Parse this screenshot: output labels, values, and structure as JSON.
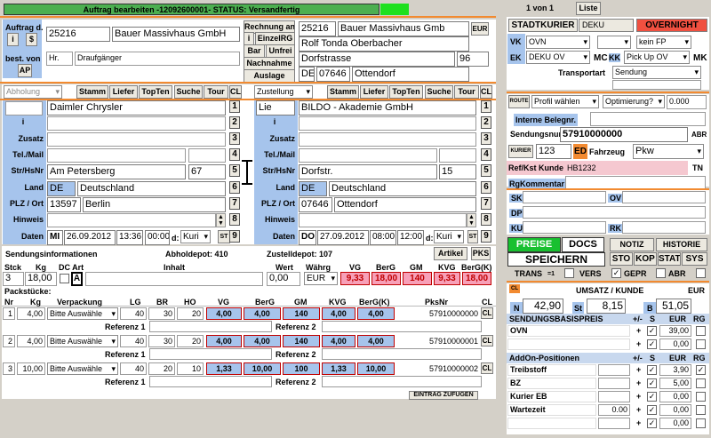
{
  "status_bar": {
    "text": "Auftrag bearbeiten    -12092600001-    STATUS: Versandfertig"
  },
  "left_header": {
    "auftrag_label": "Auftrag d.",
    "i_btn": "i",
    "s_btn": "$",
    "best_von_label": "best. von",
    "ap_btn": "AP",
    "customer_no": "25216",
    "customer_name": "Bauer Massivhaus GmbH",
    "salutation": "Hr.",
    "contact": "Draufgänger",
    "rechnung_an": "Rechnung an",
    "i2": "i",
    "einzelrg": "EinzelRG",
    "bar": "Bar",
    "unfrei": "Unfrei",
    "nachnahme": "Nachnahme",
    "auslage": "Auslage",
    "bill_no": "25216",
    "bill_name": "Bauer Massivhaus Gmb",
    "eur": "EUR",
    "bill_contact": "Rolf Tonda Oberbacher",
    "bill_street": "Dorfstrasse",
    "bill_house": "96",
    "bill_country": "DE",
    "bill_zip": "07646",
    "bill_city": "Ottendorf"
  },
  "pickup": {
    "mode": "Abholung",
    "buttons": [
      "Stamm",
      "Liefer",
      "TopTen",
      "Suche",
      "Tour",
      "CL"
    ],
    "company": "Daimler Chrysler",
    "street": "Am Petersberg",
    "house": "67",
    "country_code": "DE",
    "country": "Deutschland",
    "zip": "13597",
    "city": "Berlin",
    "day": "MI",
    "date": "26.09.2012",
    "time_from": "13:36",
    "time_to": "00:00",
    "d_label": "d:",
    "d_value": "Kuri",
    "st": "ST"
  },
  "delivery": {
    "mode": "Zustellung",
    "buttons": [
      "Stamm",
      "Liefer",
      "TopTen",
      "Suche",
      "Tour",
      "CL"
    ],
    "salutation": "Lie",
    "company": "BILDO - Akademie GmbH",
    "street": "Dorfstr.",
    "house": "15",
    "country_code": "DE",
    "country": "Deutschland",
    "zip": "07646",
    "city": "Ottendorf",
    "day": "DO",
    "date": "27.09.2012",
    "time_from": "08:00",
    "time_to": "12:00",
    "d_label": "d:",
    "d_value": "Kuri",
    "st": "ST"
  },
  "row_labels": [
    "i",
    "Zusatz",
    "Tel./Mail",
    "Str/HsNr",
    "Land",
    "PLZ / Ort",
    "Hinweis",
    "Daten"
  ],
  "row_numbers": [
    "1",
    "2",
    "3",
    "4",
    "5",
    "6",
    "7",
    "8",
    "9"
  ],
  "info": {
    "sendungsinfo": "Sendungsinformationen",
    "abholdepot": "Abholdepot: 410",
    "zustelldepot": "Zustelldepot: 107",
    "artikel": "Artikel",
    "pks": "PKS"
  },
  "summary": {
    "headers": [
      "Stck",
      "Kg",
      "DC Art",
      "Inhalt",
      "Wert",
      "Währg",
      "VG",
      "BerG",
      "GM",
      "KVG",
      "BerG(K)"
    ],
    "stck": "3",
    "kg": "18,00",
    "art": "A",
    "wert": "0,00",
    "waehrung": "EUR",
    "vg": "9,33",
    "berg": "18,00",
    "gm": "140",
    "kvg": "9,33",
    "bergk": "18,00"
  },
  "packages": {
    "title": "Packstücke:",
    "headers": [
      "Nr",
      "Kg",
      "Verpackung",
      "LG",
      "BR",
      "HO",
      "VG",
      "BerG",
      "GM",
      "KVG",
      "BerG(K)",
      "PksNr",
      "CL"
    ],
    "ref1": "Referenz 1",
    "ref2": "Referenz 2",
    "rows": [
      {
        "nr": "1",
        "kg": "4,00",
        "pack": "Bitte Auswähle",
        "lg": "40",
        "br": "30",
        "ho": "20",
        "vg": "4,00",
        "berg": "4,00",
        "gm": "140",
        "kvg": "4,00",
        "bergk": "4,00",
        "pksnr": "57910000000",
        "cl": "CL"
      },
      {
        "nr": "2",
        "kg": "4,00",
        "pack": "Bitte Auswähle",
        "lg": "40",
        "br": "30",
        "ho": "20",
        "vg": "4,00",
        "berg": "4,00",
        "gm": "140",
        "kvg": "4,00",
        "bergk": "4,00",
        "pksnr": "57910000001",
        "cl": "CL"
      },
      {
        "nr": "3",
        "kg": "10,00",
        "pack": "Bitte Auswähle",
        "lg": "40",
        "br": "20",
        "ho": "10",
        "vg": "1,33",
        "berg": "10,00",
        "gm": "100",
        "kvg": "1,33",
        "bergk": "10,00",
        "pksnr": "57910000002",
        "cl": "CL"
      }
    ],
    "add_entry": "EINTRAG ZUFÜGEN"
  },
  "right": {
    "page": "1 von 1",
    "liste": "Liste",
    "stadtkurier": "STADTKURIER",
    "deku": "DEKU",
    "overnight": "OVERNIGHT",
    "vk_label": "VK",
    "vk_value": "OVN",
    "kein_fp": "kein FP",
    "ek_label": "EK",
    "ek_value": "DEKU OV",
    "mc": "MC",
    "kk": "KK",
    "pickup_ov": "Pick Up OV",
    "mk": "MK",
    "transportart_label": "Transportart",
    "transportart": "Sendung",
    "route": "ROUTE",
    "profil": "Profil wählen",
    "optimierung": "Optimierung?",
    "route_value": "0.000",
    "interne_label": "Interne Belegnr.",
    "sendungsnr_label": "Sendungsnummer",
    "sendungsnr": "57910000000",
    "abr": "ABR",
    "kurier_label": "KURIER",
    "kurier_value": "123",
    "ed": "ED",
    "fahrzeug_label": "Fahrzeug",
    "fahrzeug": "Pkw",
    "refkst_label": "Ref/Kst Kunde",
    "refkst": "HB1232",
    "tn": "TN",
    "rgkommentar_label": "RgKommentar",
    "sk": "SK",
    "ov": "OV",
    "dp": "DP",
    "ku": "KU",
    "rk": "RK",
    "preise": "PREISE",
    "docs": "DOCS",
    "notiz": "NOTIZ",
    "historie": "HISTORIE",
    "speichern": "SPEICHERN",
    "sto": "STO",
    "kop": "KOP",
    "stat": "STAT",
    "sys": "SYS",
    "trans": "TRANS",
    "eq1": "=1",
    "vers": "VERS",
    "gepr": "GEPR",
    "abr2": "ABR",
    "cl": "CL",
    "umsatz_label": "UMSATZ / KUNDE",
    "umsatz_eur": "EUR",
    "n_label": "N",
    "n_value": "42,90",
    "st_label": "St",
    "st_value": "8,15",
    "b_label": "B",
    "b_value": "51,05",
    "basispreis_hdr": "SENDUNGSBASISPREIS",
    "col_pm": "+/-",
    "col_s": "S",
    "col_eur": "EUR",
    "col_rg": "RG",
    "basis_rows": [
      {
        "name": "OVN",
        "pm": "+",
        "eur": "39,00"
      },
      {
        "name": "",
        "pm": "+",
        "eur": "0,00"
      }
    ],
    "addon_hdr": "AddOn-Positionen",
    "addon_rows": [
      {
        "name": "Treibstoff",
        "val": "",
        "pm": "+",
        "eur": "3,90"
      },
      {
        "name": "BZ",
        "val": "",
        "pm": "+",
        "eur": "5,00"
      },
      {
        "name": "Kurier EB",
        "val": "",
        "pm": "+",
        "eur": "0,00"
      },
      {
        "name": "Wartezeit",
        "val": "0.00",
        "pm": "+",
        "eur": "0,00"
      },
      {
        "name": "",
        "val": "",
        "pm": "+",
        "eur": "0,00"
      }
    ]
  }
}
